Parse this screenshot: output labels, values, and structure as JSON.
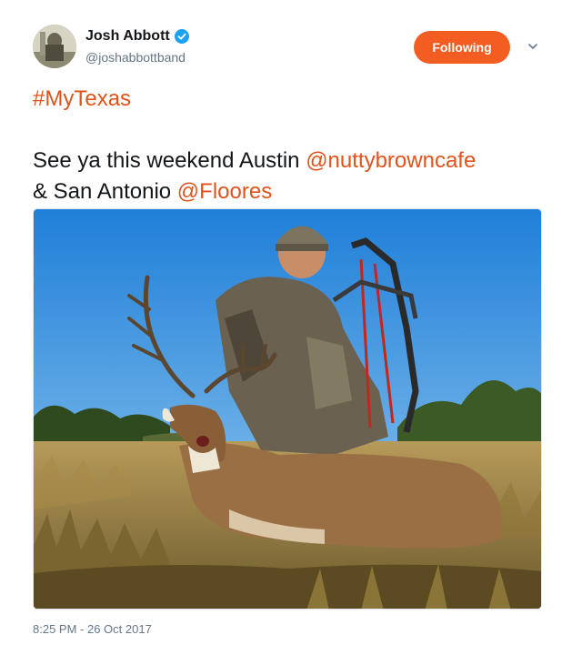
{
  "user": {
    "display_name": "Josh Abbott",
    "handle": "@joshabbottband",
    "verified": true
  },
  "follow_button": {
    "label": "Following"
  },
  "menu": {
    "icon": "chevron-down-icon"
  },
  "tweet": {
    "hashtag": "#MyTexas",
    "line1_prefix": "See ya this weekend Austin ",
    "mention1": "@nuttybrowncafe",
    "line2_prefix": "& San Antonio ",
    "mention2": "@Floores",
    "timestamp": "8:25 PM - 26 Oct 2017"
  },
  "colors": {
    "accent": "#f45d22",
    "link": "#e0531b",
    "verified": "#1da1f2",
    "secondary_text": "#657786"
  }
}
